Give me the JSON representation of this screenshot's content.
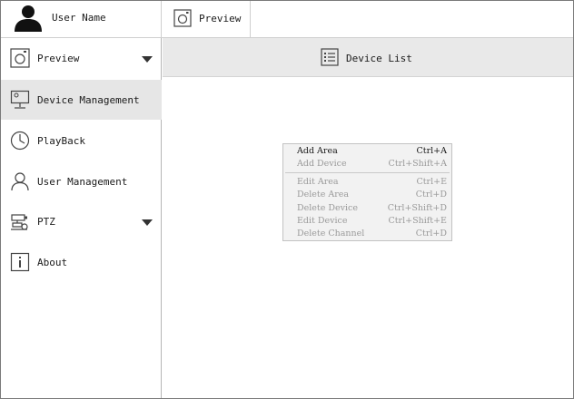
{
  "header": {
    "user_name": "User Name",
    "tab_label": "Preview"
  },
  "sidebar": {
    "items": [
      {
        "label": "Preview",
        "icon": "camera-icon",
        "expandable": true,
        "active": false
      },
      {
        "label": "Device Management",
        "icon": "monitor-icon",
        "expandable": false,
        "active": true
      },
      {
        "label": "PlayBack",
        "icon": "clock-icon",
        "expandable": false,
        "active": false
      },
      {
        "label": "User Management",
        "icon": "user-icon",
        "expandable": false,
        "active": false
      },
      {
        "label": "PTZ",
        "icon": "ptz-camera-icon",
        "expandable": true,
        "active": false
      },
      {
        "label": "About",
        "icon": "info-icon",
        "expandable": false,
        "active": false
      }
    ]
  },
  "main": {
    "header_label": "Device List"
  },
  "context_menu": {
    "items": [
      {
        "label": "Add Area",
        "shortcut": "Ctrl+A",
        "enabled": true
      },
      {
        "label": "Add Device",
        "shortcut": "Ctrl+Shift+A",
        "enabled": false
      },
      {
        "label": "Edit Area",
        "shortcut": "Ctrl+E",
        "enabled": false
      },
      {
        "label": "Delete Area",
        "shortcut": "Ctrl+D",
        "enabled": false
      },
      {
        "label": "Delete Device",
        "shortcut": "Ctrl+Shift+D",
        "enabled": false
      },
      {
        "label": "Edit Device",
        "shortcut": "Ctrl+Shift+E",
        "enabled": false
      },
      {
        "label": "Delete Channel",
        "shortcut": "Ctrl+D",
        "enabled": false
      }
    ]
  },
  "colors": {
    "active_bg": "#e6e6e6",
    "header_bg": "#e9e9e9",
    "menu_bg": "#f2f2f2",
    "disabled_text": "#9a9a9a"
  }
}
